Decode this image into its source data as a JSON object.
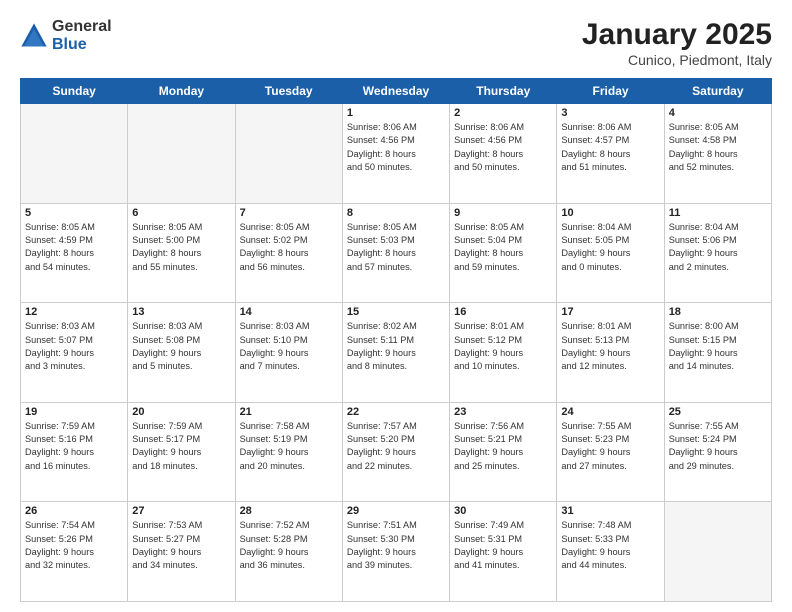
{
  "header": {
    "logo": {
      "general": "General",
      "blue": "Blue"
    },
    "title": "January 2025",
    "location": "Cunico, Piedmont, Italy"
  },
  "weekdays": [
    "Sunday",
    "Monday",
    "Tuesday",
    "Wednesday",
    "Thursday",
    "Friday",
    "Saturday"
  ],
  "weeks": [
    [
      {
        "day": "",
        "info": ""
      },
      {
        "day": "",
        "info": ""
      },
      {
        "day": "",
        "info": ""
      },
      {
        "day": "1",
        "info": "Sunrise: 8:06 AM\nSunset: 4:56 PM\nDaylight: 8 hours\nand 50 minutes."
      },
      {
        "day": "2",
        "info": "Sunrise: 8:06 AM\nSunset: 4:56 PM\nDaylight: 8 hours\nand 50 minutes."
      },
      {
        "day": "3",
        "info": "Sunrise: 8:06 AM\nSunset: 4:57 PM\nDaylight: 8 hours\nand 51 minutes."
      },
      {
        "day": "4",
        "info": "Sunrise: 8:05 AM\nSunset: 4:58 PM\nDaylight: 8 hours\nand 52 minutes."
      }
    ],
    [
      {
        "day": "5",
        "info": "Sunrise: 8:05 AM\nSunset: 4:59 PM\nDaylight: 8 hours\nand 54 minutes."
      },
      {
        "day": "6",
        "info": "Sunrise: 8:05 AM\nSunset: 5:00 PM\nDaylight: 8 hours\nand 55 minutes."
      },
      {
        "day": "7",
        "info": "Sunrise: 8:05 AM\nSunset: 5:02 PM\nDaylight: 8 hours\nand 56 minutes."
      },
      {
        "day": "8",
        "info": "Sunrise: 8:05 AM\nSunset: 5:03 PM\nDaylight: 8 hours\nand 57 minutes."
      },
      {
        "day": "9",
        "info": "Sunrise: 8:05 AM\nSunset: 5:04 PM\nDaylight: 8 hours\nand 59 minutes."
      },
      {
        "day": "10",
        "info": "Sunrise: 8:04 AM\nSunset: 5:05 PM\nDaylight: 9 hours\nand 0 minutes."
      },
      {
        "day": "11",
        "info": "Sunrise: 8:04 AM\nSunset: 5:06 PM\nDaylight: 9 hours\nand 2 minutes."
      }
    ],
    [
      {
        "day": "12",
        "info": "Sunrise: 8:03 AM\nSunset: 5:07 PM\nDaylight: 9 hours\nand 3 minutes."
      },
      {
        "day": "13",
        "info": "Sunrise: 8:03 AM\nSunset: 5:08 PM\nDaylight: 9 hours\nand 5 minutes."
      },
      {
        "day": "14",
        "info": "Sunrise: 8:03 AM\nSunset: 5:10 PM\nDaylight: 9 hours\nand 7 minutes."
      },
      {
        "day": "15",
        "info": "Sunrise: 8:02 AM\nSunset: 5:11 PM\nDaylight: 9 hours\nand 8 minutes."
      },
      {
        "day": "16",
        "info": "Sunrise: 8:01 AM\nSunset: 5:12 PM\nDaylight: 9 hours\nand 10 minutes."
      },
      {
        "day": "17",
        "info": "Sunrise: 8:01 AM\nSunset: 5:13 PM\nDaylight: 9 hours\nand 12 minutes."
      },
      {
        "day": "18",
        "info": "Sunrise: 8:00 AM\nSunset: 5:15 PM\nDaylight: 9 hours\nand 14 minutes."
      }
    ],
    [
      {
        "day": "19",
        "info": "Sunrise: 7:59 AM\nSunset: 5:16 PM\nDaylight: 9 hours\nand 16 minutes."
      },
      {
        "day": "20",
        "info": "Sunrise: 7:59 AM\nSunset: 5:17 PM\nDaylight: 9 hours\nand 18 minutes."
      },
      {
        "day": "21",
        "info": "Sunrise: 7:58 AM\nSunset: 5:19 PM\nDaylight: 9 hours\nand 20 minutes."
      },
      {
        "day": "22",
        "info": "Sunrise: 7:57 AM\nSunset: 5:20 PM\nDaylight: 9 hours\nand 22 minutes."
      },
      {
        "day": "23",
        "info": "Sunrise: 7:56 AM\nSunset: 5:21 PM\nDaylight: 9 hours\nand 25 minutes."
      },
      {
        "day": "24",
        "info": "Sunrise: 7:55 AM\nSunset: 5:23 PM\nDaylight: 9 hours\nand 27 minutes."
      },
      {
        "day": "25",
        "info": "Sunrise: 7:55 AM\nSunset: 5:24 PM\nDaylight: 9 hours\nand 29 minutes."
      }
    ],
    [
      {
        "day": "26",
        "info": "Sunrise: 7:54 AM\nSunset: 5:26 PM\nDaylight: 9 hours\nand 32 minutes."
      },
      {
        "day": "27",
        "info": "Sunrise: 7:53 AM\nSunset: 5:27 PM\nDaylight: 9 hours\nand 34 minutes."
      },
      {
        "day": "28",
        "info": "Sunrise: 7:52 AM\nSunset: 5:28 PM\nDaylight: 9 hours\nand 36 minutes."
      },
      {
        "day": "29",
        "info": "Sunrise: 7:51 AM\nSunset: 5:30 PM\nDaylight: 9 hours\nand 39 minutes."
      },
      {
        "day": "30",
        "info": "Sunrise: 7:49 AM\nSunset: 5:31 PM\nDaylight: 9 hours\nand 41 minutes."
      },
      {
        "day": "31",
        "info": "Sunrise: 7:48 AM\nSunset: 5:33 PM\nDaylight: 9 hours\nand 44 minutes."
      },
      {
        "day": "",
        "info": ""
      }
    ]
  ]
}
